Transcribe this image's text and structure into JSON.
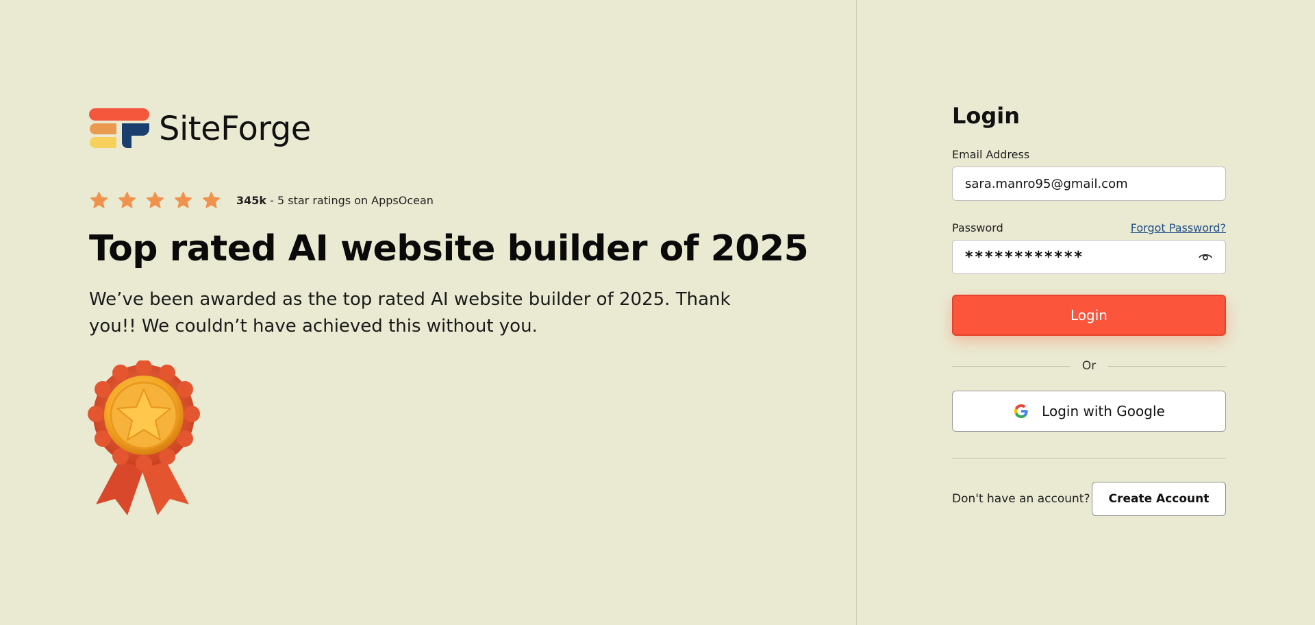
{
  "brand": {
    "name": "SiteForge",
    "logo_colors": [
      "#f4573b",
      "#ea9a4f",
      "#f7d15c",
      "#1a3f6e"
    ]
  },
  "rating": {
    "count": "345k",
    "text": " - 5 star ratings on AppsOcean",
    "stars": 5,
    "star_color": "#f0924b"
  },
  "hero": {
    "headline": "Top rated AI website builder of 2025",
    "subtext": "We’ve been awarded as the top rated AI website builder of 2025. Thank you!! We couldn’t have achieved this without you.",
    "badge_icon": "award-ribbon-icon"
  },
  "login_form": {
    "title": "Login",
    "email_label": "Email Address",
    "email_value": "sara.manro95@gmail.com",
    "password_label": "Password",
    "forgot_password": "Forgot Password?",
    "password_value": "************",
    "login_button": "Login",
    "or_text": "Or",
    "google_button": "Login with Google",
    "no_account_text": "Don't have an account?",
    "create_account_button": "Create Account"
  },
  "colors": {
    "background": "#eaead3",
    "primary": "#fb563b",
    "link": "#1f4f86"
  }
}
